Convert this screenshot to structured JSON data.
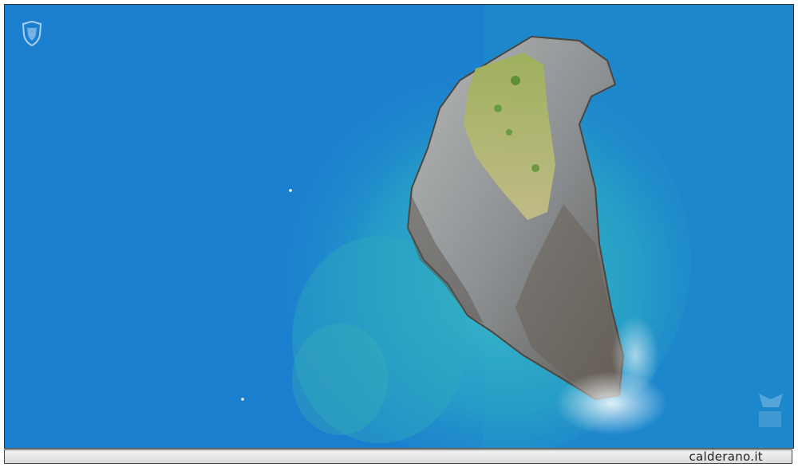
{
  "footer": {
    "site": "calderano.it"
  },
  "watermark": {
    "icon": "crest-logo-icon"
  },
  "colors": {
    "deep_sea": "#1a7ccc",
    "shallow_sea": "#2fb3c8",
    "rock": "#8a8f93",
    "vegetation": "#a9b56a"
  }
}
